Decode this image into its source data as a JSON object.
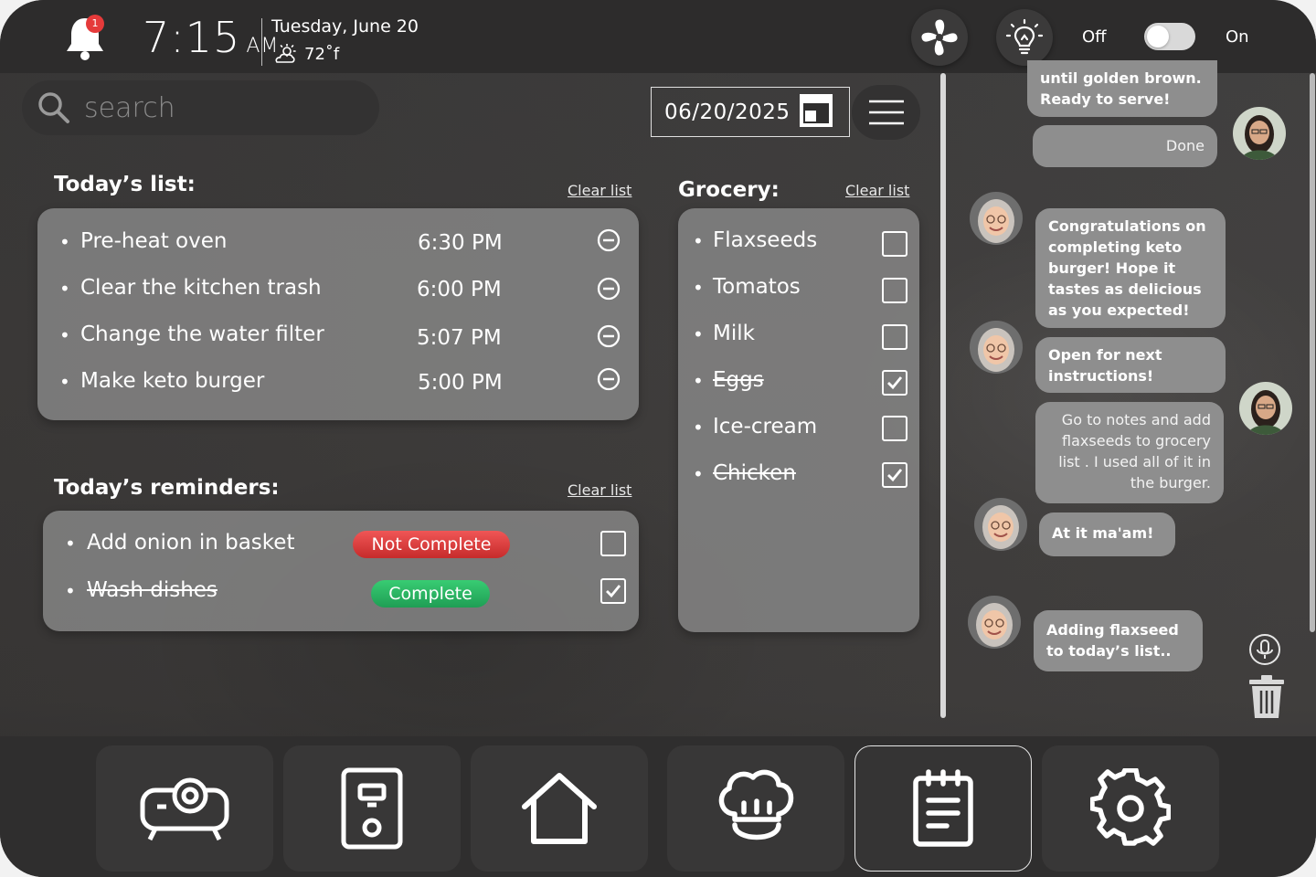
{
  "status_bar": {
    "notification_count": "1",
    "time": "7:15",
    "ampm": "AM",
    "date": "Tuesday, June 20",
    "temperature": "72˚f",
    "toggle_off_label": "Off",
    "toggle_on_label": "On",
    "toggle_state": "off",
    "icons": [
      "bell-icon",
      "weather-cloud-sun-icon",
      "fan-icon",
      "light-bulb-icon"
    ]
  },
  "search": {
    "placeholder": "search"
  },
  "date_picker": {
    "value": "06/20/2025"
  },
  "todays_list": {
    "title": "Today’s list:",
    "clear_label": "Clear list",
    "items": [
      {
        "text": "Pre-heat oven",
        "time": "6:30 PM"
      },
      {
        "text": "Clear the kitchen trash",
        "time": "6:00 PM"
      },
      {
        "text": "Change the water filter",
        "time": "5:07 PM"
      },
      {
        "text": "Make keto burger",
        "time": "5:00 PM"
      }
    ]
  },
  "reminders": {
    "title": "Today’s reminders:",
    "clear_label": "Clear list",
    "items": [
      {
        "text": "Add onion in basket",
        "status": "Not Complete",
        "checked": false
      },
      {
        "text": "Wash dishes",
        "status": "Complete",
        "checked": true
      }
    ]
  },
  "grocery": {
    "title": "Grocery:",
    "clear_label": "Clear list",
    "items": [
      {
        "text": "Flaxseeds",
        "checked": false
      },
      {
        "text": "Tomatos",
        "checked": false
      },
      {
        "text": "Milk",
        "checked": false
      },
      {
        "text": "Eggs",
        "checked": true
      },
      {
        "text": "Ice-cream",
        "checked": false
      },
      {
        "text": "Chicken",
        "checked": true
      }
    ]
  },
  "chat": {
    "messages": [
      {
        "from": "assistant",
        "text": "until golden brown. Ready to serve!"
      },
      {
        "from": "user",
        "text": "Done"
      },
      {
        "from": "assistant",
        "text": "Congratulations on completing keto burger! Hope it tastes as delicious as you expected!"
      },
      {
        "from": "assistant",
        "text": "Open for next instructions!"
      },
      {
        "from": "user",
        "text": "Go to notes and add flaxseeds to grocery list .  I used all of it in the burger."
      },
      {
        "from": "assistant",
        "text": "At it ma'am!"
      },
      {
        "from": "assistant",
        "text": "Adding flaxseed to today’s list.."
      }
    ],
    "controls": [
      "microphone-icon",
      "trash-icon"
    ]
  },
  "bottom_nav": {
    "items": [
      "projector-icon",
      "appliance-icon",
      "home-icon",
      "chef-hat-icon",
      "notes-icon",
      "settings-icon"
    ],
    "active": "notes-icon"
  },
  "colors": {
    "panel": "#8c8c8c",
    "not_complete": "#e04343",
    "complete": "#2bb766",
    "notification_badge": "#e53a3a",
    "background": "#3a3939"
  }
}
